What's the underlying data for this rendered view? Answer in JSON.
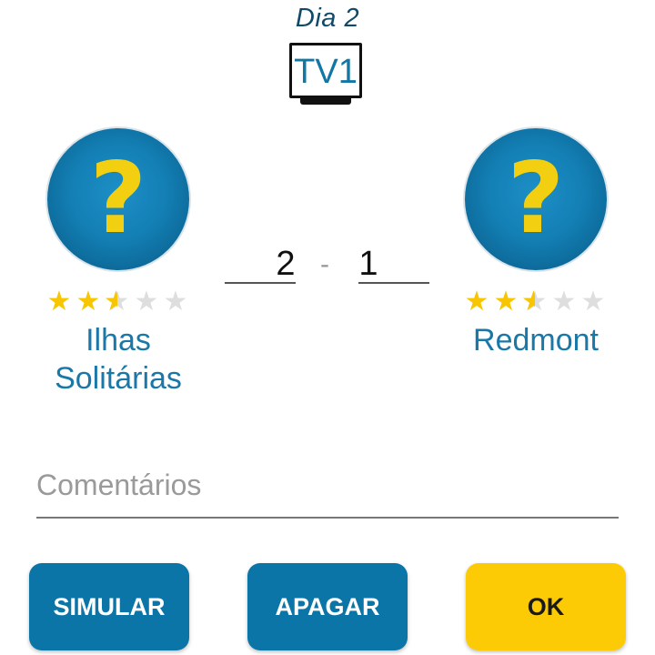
{
  "header": {
    "day_label": "Dia  2",
    "channel": "TV1"
  },
  "home_team": {
    "crest_symbol": "?",
    "name_line1": "Ilhas",
    "name_line2": "Solitárias",
    "rating_stars": 2.5,
    "rating_max": 5
  },
  "away_team": {
    "crest_symbol": "?",
    "name": "Redmont",
    "rating_stars": 2.5,
    "rating_max": 5
  },
  "score": {
    "home": "2",
    "separator": "-",
    "away": "1"
  },
  "comments": {
    "placeholder": "Comentários",
    "value": ""
  },
  "buttons": {
    "simulate": "SIMULAR",
    "clear": "APAGAR",
    "ok": "OK"
  },
  "colors": {
    "accent_blue": "#0b75a8",
    "accent_yellow": "#fdcb06",
    "star_filled": "#f7c600",
    "star_empty": "#dedede"
  }
}
